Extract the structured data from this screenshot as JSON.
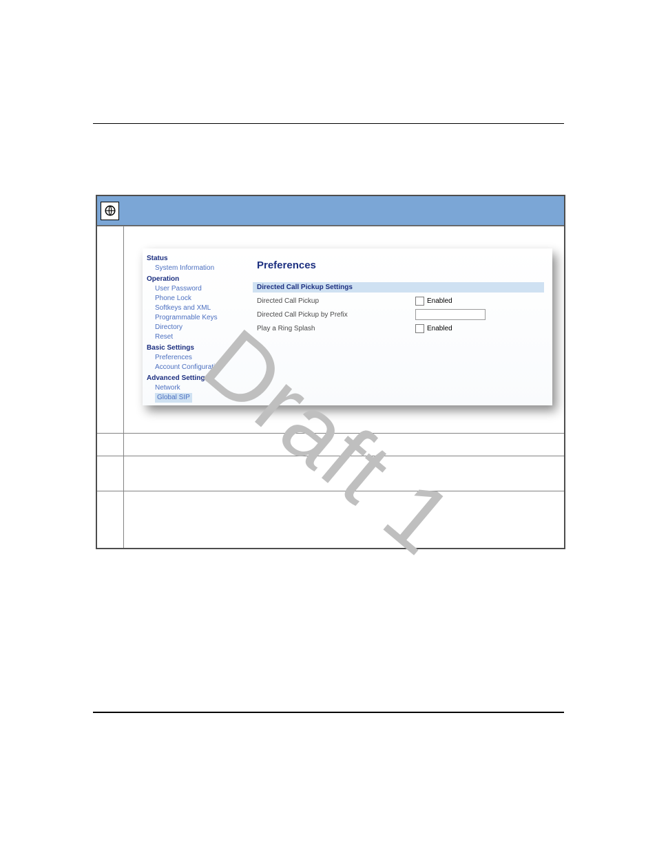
{
  "watermark": "Draft 1",
  "nav": {
    "status": {
      "header": "Status",
      "items": [
        "System Information"
      ]
    },
    "operation": {
      "header": "Operation",
      "items": [
        "User Password",
        "Phone Lock",
        "Softkeys and XML",
        "Programmable Keys",
        "Directory",
        "Reset"
      ]
    },
    "basic": {
      "header": "Basic Settings",
      "items": [
        "Preferences",
        "Account Configuration"
      ]
    },
    "advanced": {
      "header": "Advanced Settings",
      "items": [
        "Network",
        "Global SIP"
      ]
    }
  },
  "content": {
    "title": "Preferences",
    "section_header": "Directed Call Pickup Settings",
    "rows": {
      "r1": {
        "label": "Directed Call Pickup",
        "ctrl_label": "Enabled"
      },
      "r2": {
        "label": "Directed Call Pickup by Prefix"
      },
      "r3": {
        "label": "Play a Ring Splash",
        "ctrl_label": "Enabled"
      }
    }
  }
}
